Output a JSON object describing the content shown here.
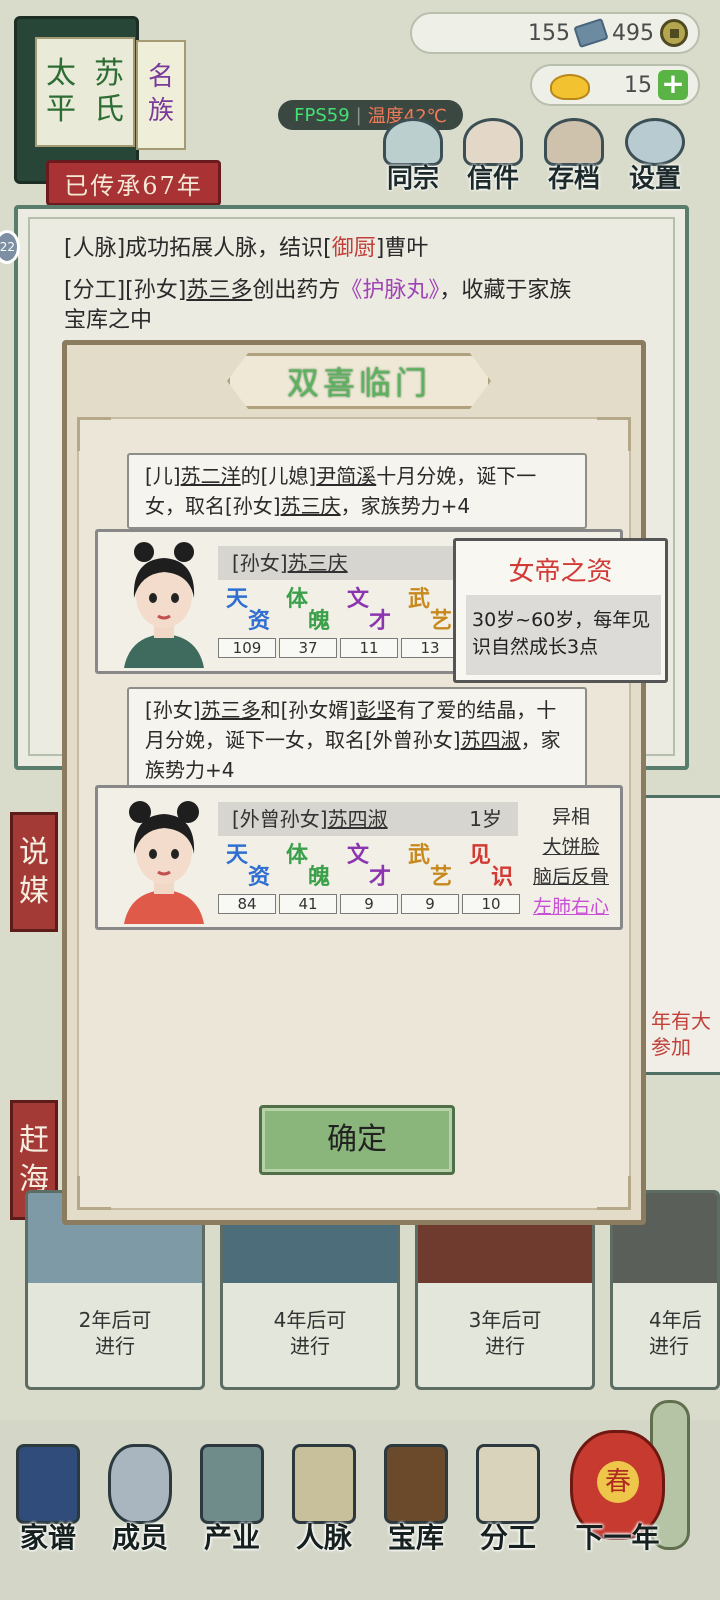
{
  "family": {
    "title_col1": [
      "太",
      "平"
    ],
    "title_col2": [
      "苏",
      "氏"
    ],
    "rank": [
      "名",
      "族"
    ],
    "banner": "已传承67年"
  },
  "resources": {
    "jade": "155",
    "coin": "495",
    "gold": "15"
  },
  "status": {
    "fps": "FPS59",
    "temp": "温度42℃"
  },
  "top_menu": [
    "同宗",
    "信件",
    "存档",
    "设置"
  ],
  "round_badge": "22",
  "log": {
    "line1_a": "[人脉]成功拓展人脉，结识[",
    "line1_b": "御厨",
    "line1_c": "]曹叶",
    "line2_a": "[分工][孙女]",
    "line2_b": "苏三多",
    "line2_c": "创出药方",
    "line2_d": "《护脉丸》",
    "line2_e": "，收藏于家族",
    "line3": "宝库之中"
  },
  "side_labels": {
    "left_top": [
      "说",
      "媒"
    ],
    "left_bottom": [
      "赶",
      "海"
    ]
  },
  "bg_right_text": [
    "年有大",
    "参加"
  ],
  "bg_cards": [
    "2年后可\n进行",
    "4年后可\n进行",
    "3年后可\n进行",
    "4年后\n进行"
  ],
  "modal": {
    "title": "双喜临门",
    "msg1_a": "[儿]",
    "msg1_b": "苏二洋",
    "msg1_c": "的[儿媳]",
    "msg1_d": "尹简溪",
    "msg1_e": "十月分娩，诞下一女，取名[孙女]",
    "msg1_f": "苏三庆",
    "msg1_g": "，家族势力+4",
    "char1": {
      "role": "[孙女]",
      "name": "苏三庆",
      "attrs": [
        {
          "c1": "天",
          "c2": "资",
          "value": "109"
        },
        {
          "c1": "体",
          "c2": "魄",
          "value": "37"
        },
        {
          "c1": "文",
          "c2": "才",
          "value": "11"
        },
        {
          "c1": "武",
          "c2": "艺",
          "value": "13"
        }
      ]
    },
    "msg2_a": "[孙女]",
    "msg2_b": "苏三多",
    "msg2_c": "和[孙女婿]",
    "msg2_d": "彭坚",
    "msg2_e": "有了爱的结晶，十月分娩，诞下一女，取名[外曾孙女]",
    "msg2_f": "苏四淑",
    "msg2_g": "，家族势力+4",
    "char2": {
      "role": "[外曾孙女]",
      "name": "苏四淑",
      "age": "1岁",
      "attrs": [
        {
          "c1": "天",
          "c2": "资",
          "value": "84"
        },
        {
          "c1": "体",
          "c2": "魄",
          "value": "41"
        },
        {
          "c1": "文",
          "c2": "才",
          "value": "9"
        },
        {
          "c1": "武",
          "c2": "艺",
          "value": "9"
        },
        {
          "c1": "见",
          "c2": "识",
          "value": "10"
        }
      ],
      "traits_header": "异相",
      "traits": [
        "大饼脸",
        "脑后反骨",
        "左肺右心"
      ]
    },
    "confirm": "确定"
  },
  "tooltip": {
    "title": "女帝之资",
    "body": "30岁~60岁，每年见识自然成长3点"
  },
  "nav": [
    "家谱",
    "成员",
    "产业",
    "人脉",
    "宝库",
    "分工",
    "下一年"
  ],
  "colors": {
    "accent_green": "#5db25f",
    "red": "#c1403a",
    "purple": "#a043b5",
    "panel_border": "#5a7c6c"
  }
}
